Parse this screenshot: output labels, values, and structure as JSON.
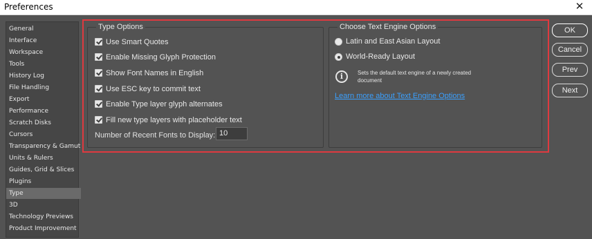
{
  "window": {
    "title": "Preferences",
    "close_glyph": "✕"
  },
  "sidebar": {
    "items": [
      {
        "label": "General"
      },
      {
        "label": "Interface"
      },
      {
        "label": "Workspace"
      },
      {
        "label": "Tools"
      },
      {
        "label": "History Log"
      },
      {
        "label": "File Handling"
      },
      {
        "label": "Export"
      },
      {
        "label": "Performance"
      },
      {
        "label": "Scratch Disks"
      },
      {
        "label": "Cursors"
      },
      {
        "label": "Transparency & Gamut"
      },
      {
        "label": "Units & Rulers"
      },
      {
        "label": "Guides, Grid & Slices"
      },
      {
        "label": "Plugins"
      },
      {
        "label": "Type",
        "selected": true
      },
      {
        "label": "3D"
      },
      {
        "label": "Technology Previews"
      },
      {
        "label": "Product Improvement"
      }
    ]
  },
  "type_options": {
    "title": "Type Options",
    "checkboxes": [
      {
        "label": "Use Smart Quotes",
        "checked": true
      },
      {
        "label": "Enable Missing Glyph Protection",
        "checked": true
      },
      {
        "label": "Show Font Names in English",
        "checked": true
      },
      {
        "label": "Use ESC key to commit text",
        "checked": true
      },
      {
        "label": "Enable Type layer glyph alternates",
        "checked": true
      },
      {
        "label": "Fill new type layers with placeholder text",
        "checked": true
      }
    ],
    "recent_fonts_label": "Number of Recent Fonts to Display:",
    "recent_fonts_value": "10"
  },
  "text_engine": {
    "title": "Choose Text Engine Options",
    "options": [
      {
        "label": "Latin and East Asian Layout",
        "selected": false
      },
      {
        "label": "World-Ready Layout",
        "selected": true
      }
    ],
    "info_glyph": "i",
    "info_text": "Sets the default text engine of a newly created document",
    "link": "Learn more about Text Engine Options"
  },
  "buttons": {
    "ok": "OK",
    "cancel": "Cancel",
    "prev": "Prev",
    "next": "Next"
  },
  "colors": {
    "background": "#535353",
    "highlight": "#e0393f",
    "link": "#3aa0ff"
  }
}
